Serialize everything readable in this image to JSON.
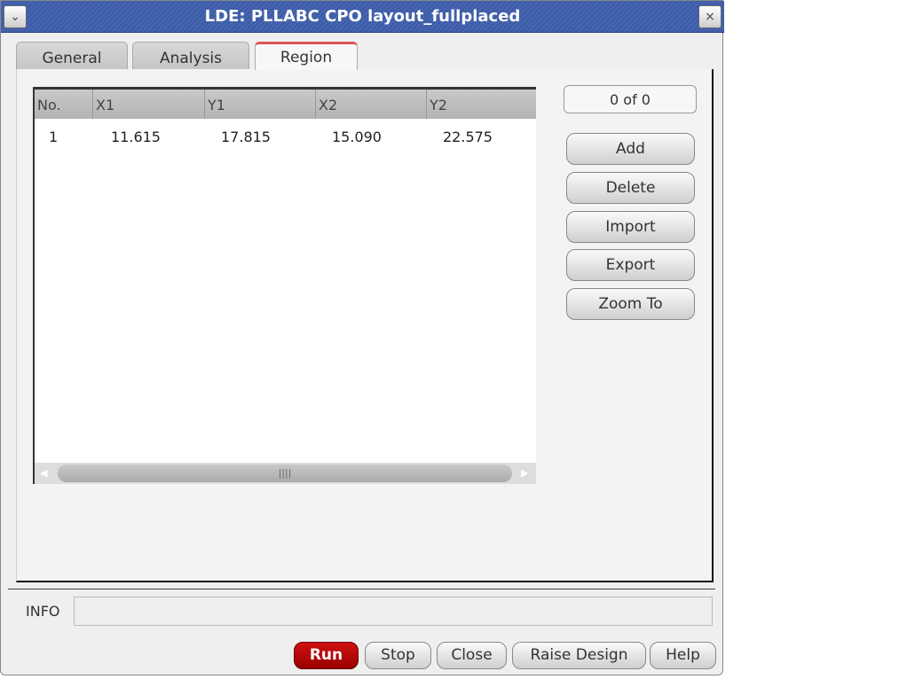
{
  "window": {
    "title": "LDE: PLLABC CPO layout_fullplaced"
  },
  "tabs": [
    {
      "label": "General"
    },
    {
      "label": "Analysis"
    },
    {
      "label": "Region",
      "active": true
    }
  ],
  "table": {
    "columns": [
      "No.",
      "X1",
      "Y1",
      "X2",
      "Y2"
    ],
    "rows": [
      [
        "1",
        "11.615",
        "17.815",
        "15.090",
        "22.575"
      ]
    ]
  },
  "counter": "0 of 0",
  "side_buttons": [
    "Add",
    "Delete",
    "Import",
    "Export",
    "Zoom To"
  ],
  "info": {
    "label": "INFO",
    "value": ""
  },
  "bottom_buttons": [
    "Run",
    "Stop",
    "Close",
    "Raise Design",
    "Help"
  ],
  "colors": {
    "title_bar": "#3d5ba6",
    "run_button": "#b00000",
    "active_tab_accent": "#d55555"
  }
}
